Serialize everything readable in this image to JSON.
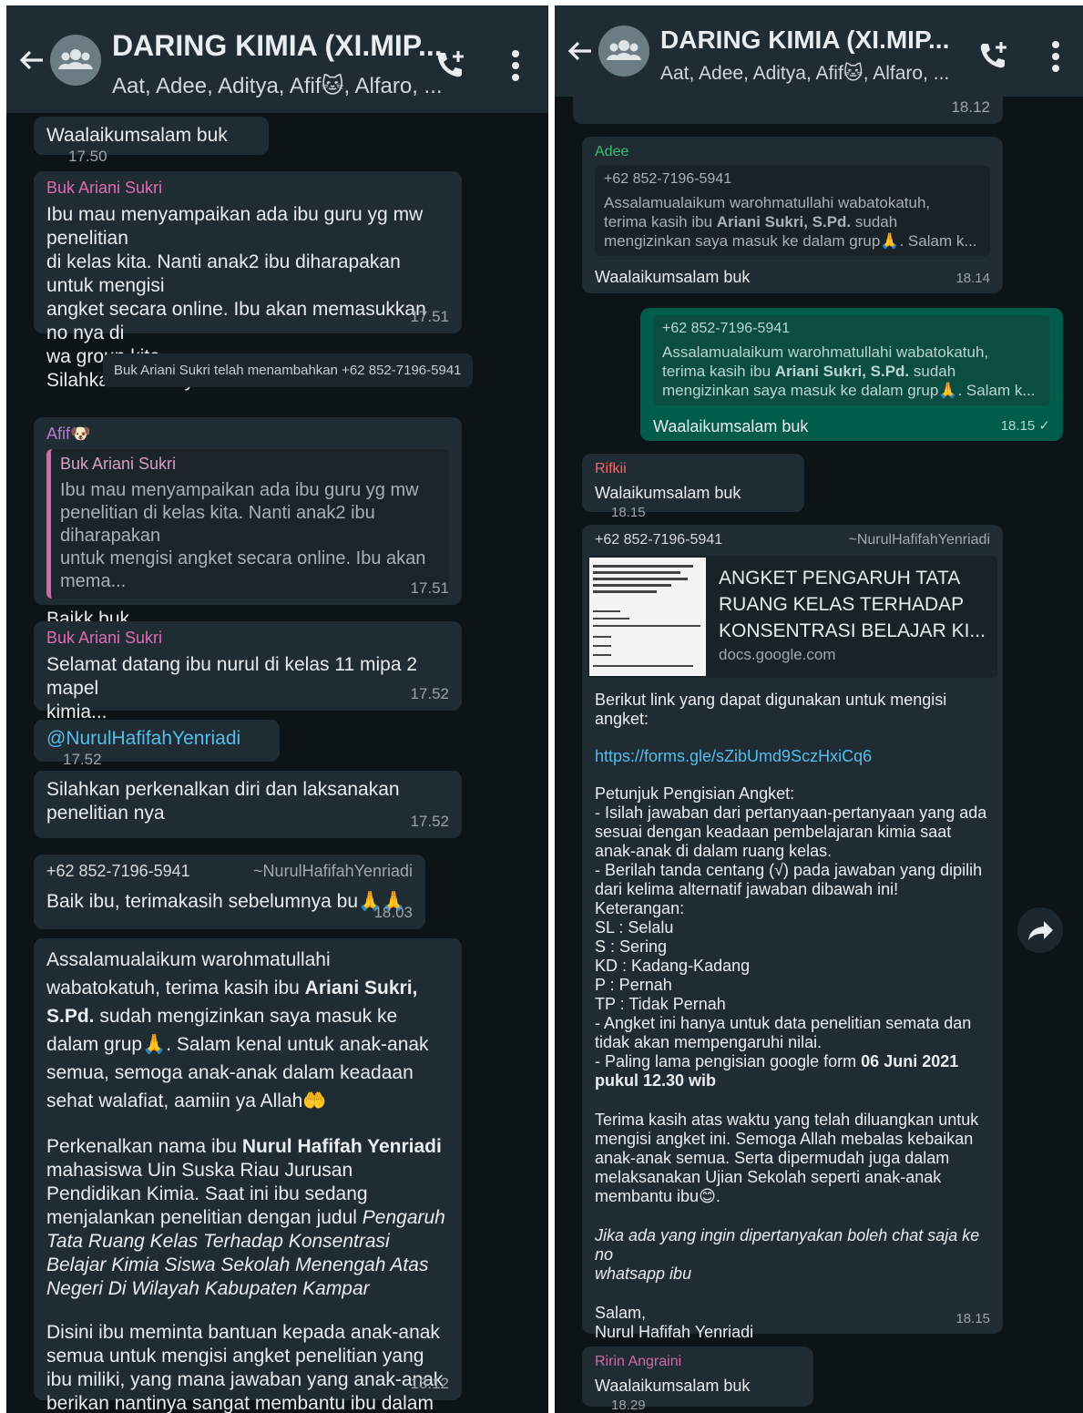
{
  "left": {
    "header": {
      "title": "DARING KIMIA (XI.MIP...",
      "subtitle": "Aat, Adee, Aditya, Afif🐱, Alfaro, ..."
    },
    "messages": [
      {
        "text": "Waalaikumsalam buk",
        "time": "17.50"
      },
      {
        "sender": "Buk Ariani Sukri",
        "text": "Ibu mau menyampaikan ada ibu guru yg mw penelitian\ndi kelas kita. Nanti anak2 ibu diharapakan untuk mengisi\nangket secara online. Ibu akan memasukkan no nya di\nwa group kita.\nSilahkan di ikuti ya...",
        "time": "17.51"
      },
      {
        "system": "Buk Ariani Sukri telah menambahkan +62 852-7196-5941"
      },
      {
        "sender": "Afif🐶",
        "quote_sender": "Buk Ariani Sukri",
        "quote_text": "Ibu mau menyampaikan ada ibu guru yg mw\npenelitian di kelas kita. Nanti anak2 ibu diharapakan\nuntuk mengisi angket secara online. Ibu akan mema...",
        "text": "Baikk buk",
        "time": "17.51"
      },
      {
        "sender": "Buk Ariani Sukri",
        "text": "Selamat datang ibu nurul di kelas 11 mipa 2 mapel\nkimia...",
        "time": "17.52"
      },
      {
        "text": "@NurulHafifahYenriadi",
        "time": "17.52"
      },
      {
        "text": "Silahkan perkenalkan diri dan laksanakan penelitian nya",
        "time": "17.52"
      },
      {
        "sender": "+62 852-7196-5941",
        "sender_alias": "~NurulHafifahYenriadi",
        "text": "Baik ibu, terimakasih sebelumnya bu🙏🙏",
        "time": "18.03"
      },
      {
        "para1": "Assalamualaikum warohmatullahi wabatokatuh, terima kasih ibu Ariani Sukri, S.Pd. sudah mengizinkan saya masuk ke dalam grup🙏. Salam kenal untuk anak-anak semua, semoga anak-anak dalam keadaan sehat walafiat, aamiin ya Allah🤲",
        "para2": "Perkenalkan nama ibu Nurul Hafifah Yenriadi mahasiswa Uin Suska Riau Jurusan Pendidikan Kimia. Saat ini ibu sedang menjalankan penelitian dengan judul Pengaruh Tata Ruang Kelas Terhadap Konsentrasi Belajar Kimia Siswa Sekolah Menengah Atas Negeri Di Wilayah Kabupaten Kampar",
        "para3": "Disini ibu meminta bantuan kepada anak-anak semua untuk mengisi angket penelitian yang ibu miliki, yang mana jawaban yang anak-anak berikan nantinya sangat membantu ibu dalam menyelesaikan tugas akhir ibu.",
        "time": "18.12"
      }
    ]
  },
  "right": {
    "header": {
      "title": "DARING KIMIA (XI.MIP...",
      "subtitle": "Aat, Adee, Aditya, Afif🐱, Alfaro, ..."
    },
    "messages": [
      {
        "time": "18.12"
      },
      {
        "sender": "Adee",
        "quote_sender": "+62 852-7196-5941",
        "quote_text": "Assalamualaikum warohmatullahi wabatokatuh,\nterima kasih ibu Ariani Sukri, S.Pd. sudah\nmengizinkan saya masuk ke dalam grup🙏. Salam k...",
        "text": "Waalaikumsalam buk",
        "time": "18.14"
      },
      {
        "quote_sender": "+62 852-7196-5941",
        "quote_text": "Assalamualaikum warohmatullahi wabatokatuh,\nterima kasih ibu Ariani Sukri, S.Pd. sudah\nmengizinkan saya masuk ke dalam grup🙏. Salam k...",
        "text": "Waalaikumsalam buk",
        "time": "18.15 ✓"
      },
      {
        "sender": "Rifkii",
        "text": "Walaikumsalam buk",
        "time": "18.15"
      },
      {
        "sender": "+62 852-7196-5941",
        "sender_alias": "~NurulHafifahYenriadi",
        "preview_title": "ANGKET PENGARUH TATA RUANG KELAS TERHADAP KONSENTRASI BELAJAR KI...",
        "preview_domain": "docs.google.com",
        "intro": "Berikut link yang dapat digunakan untuk mengisi angket:",
        "url": "https://forms.gle/sZibUmd9SczHxiCq6",
        "body": "Petunjuk Pengisian Angket:\n- Isilah jawaban dari pertanyaan-pertanyaan yang ada\nsesuai dengan keadaan pembelajaran kimia saat\nanak-anak di dalam ruang kelas.\n- Berilah tanda centang (√) pada jawaban yang dipilih\ndari kelima alternatif jawaban dibawah ini!\nKeterangan:\nSL  : Selalu\nS    : Sering\nKD : Kadang-Kadang\nP    : Pernah\nTP : Tidak Pernah\n- Angket ini hanya untuk data penelitian semata dan\ntidak akan mempengaruhi nilai.\n- Paling lama pengisian google form 06 Juni 2021\npukul 12.30 wib",
        "thanks": "Terima kasih atas waktu yang telah diluangkan untuk\nmengisi angket ini. Semoga Allah mebalas kebaikan\nanak-anak semua. Serta dipermudah juga dalam\nmelaksanakan Ujian Sekolah seperti anak-anak\nmembantu ibu😊.",
        "italic": "Jika ada yang ingin dipertanyakan boleh chat saja ke no\nwhatsapp ibu",
        "sign": "Salam,\nNurul Hafifah Yenriadi",
        "time": "18.15"
      },
      {
        "sender": "Ririn Angraini",
        "text": "Waalaikumsalam buk",
        "time": "18.29"
      }
    ]
  }
}
